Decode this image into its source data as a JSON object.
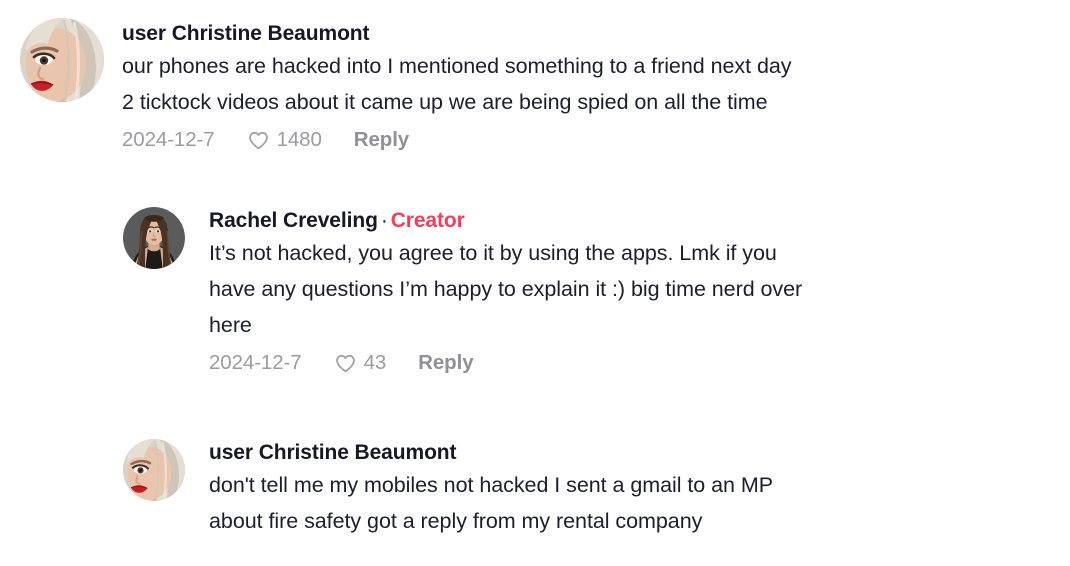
{
  "app": {
    "background_color": "#ffffff",
    "creator_badge_color": "#F2405C",
    "text_color": "#161823",
    "muted_color": "#9b9ba1"
  },
  "icons": {
    "heart": "heart-icon"
  },
  "labels": {
    "reply": "Reply",
    "creator": "Creator",
    "separator": "·"
  },
  "comments": [
    {
      "id": "comment-0",
      "level": "top-level",
      "avatar": {
        "name": "avatar-christine-beaumont",
        "alt": "Woman with platinum blonde hair and red lipstick",
        "skin": "#e8c3ad",
        "hair": "#ded6cb",
        "lip": "#c41f27",
        "bg": "#d8cfc6"
      },
      "username": "user Christine Beaumont",
      "is_creator": false,
      "text": "our phones are hacked into I mentioned something to a friend next day\n2 ticktock videos about it came up we are being spied on all the time",
      "date": "2024-12-7",
      "likes": "1480",
      "reply_label": "Reply"
    },
    {
      "id": "comment-1",
      "level": "reply",
      "avatar": {
        "name": "avatar-rachel-creveling",
        "alt": "Woman with long dark brown hair in a black top on gray background",
        "skin": "#e3b9a0",
        "hair": "#4b3326",
        "lip": "#b4685e",
        "bg": "#57585a"
      },
      "username": "Rachel Creveling",
      "is_creator": true,
      "text": "It’s not hacked, you agree to it by using the apps. Lmk if you\nhave any questions I’m happy to explain it :) big time nerd over\nhere",
      "date": "2024-12-7",
      "likes": "43",
      "reply_label": "Reply"
    },
    {
      "id": "comment-2",
      "level": "reply",
      "avatar": {
        "name": "avatar-christine-beaumont",
        "alt": "Woman with platinum blonde hair and red lipstick",
        "skin": "#e8c3ad",
        "hair": "#ded6cb",
        "lip": "#c41f27",
        "bg": "#d8cfc6"
      },
      "username": "user Christine Beaumont",
      "is_creator": false,
      "text": "don't tell me my mobiles not hacked I sent a gmail to an MP\nabout fire safety got a reply from my rental company",
      "date": "",
      "likes": "",
      "reply_label": ""
    }
  ]
}
